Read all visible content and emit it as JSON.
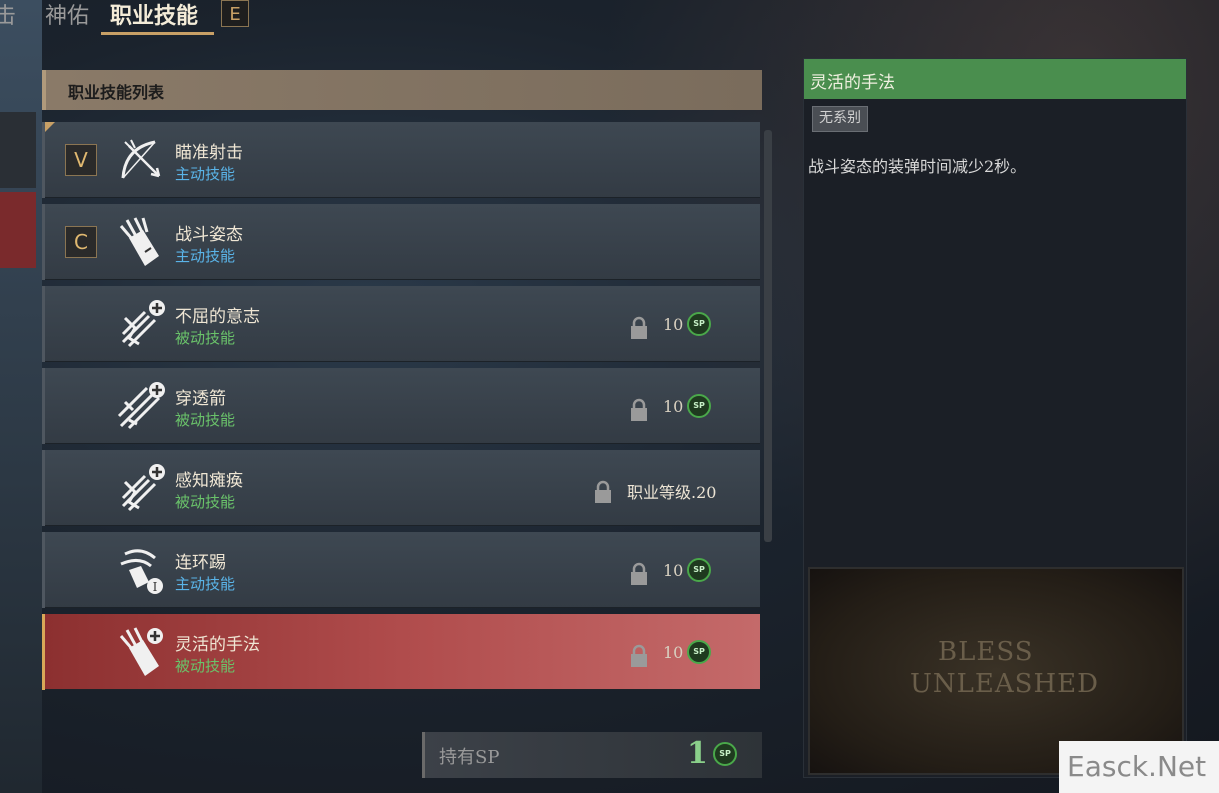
{
  "tabs": [
    {
      "label": "击"
    },
    {
      "label": "神佑"
    },
    {
      "label": "职业技能"
    }
  ],
  "tab_hotkey": "E",
  "list_header": "职业技能列表",
  "skills": [
    {
      "hotkey": "V",
      "name": "瞄准射击",
      "type": "主动技能",
      "type_color": "#5ab4e8",
      "icon": "bow-icon"
    },
    {
      "hotkey": "C",
      "name": "战斗姿态",
      "type": "主动技能",
      "type_color": "#5ab4e8",
      "icon": "quiver-icon"
    },
    {
      "name": "不屈的意志",
      "type": "被动技能",
      "type_color": "#6ac36a",
      "icon": "arrows-plus-icon",
      "cost": "10"
    },
    {
      "name": "穿透箭",
      "type": "被动技能",
      "type_color": "#6ac36a",
      "icon": "piercing-arrows-icon",
      "cost": "10"
    },
    {
      "name": "感知瘫痪",
      "type": "被动技能",
      "type_color": "#6ac36a",
      "icon": "arrows-plus-icon",
      "requirement": "职业等级.20"
    },
    {
      "name": "连环踢",
      "type": "主动技能",
      "type_color": "#5ab4e8",
      "icon": "kick-icon",
      "cost": "10"
    },
    {
      "name": "灵活的手法",
      "type": "被动技能",
      "type_color": "#6ac36a",
      "icon": "quiver-plus-icon",
      "cost": "10"
    }
  ],
  "sp_icon_text": "SP",
  "sp_footer": {
    "label": "持有SP",
    "value": "1"
  },
  "detail": {
    "title": "灵活的手法",
    "badge": "无系别",
    "description": "战斗姿态的装弹时间减少2秒。",
    "preview_logo_line1": "BLESS",
    "preview_logo_line2": "UNLEASHED"
  },
  "watermark": "Easck.Net",
  "colors": {
    "active": "#5ab4e8",
    "passive": "#6ac36a",
    "accent": "#c8a066",
    "detail_title": "#4a8e4e",
    "selected": "#b04c4c"
  }
}
